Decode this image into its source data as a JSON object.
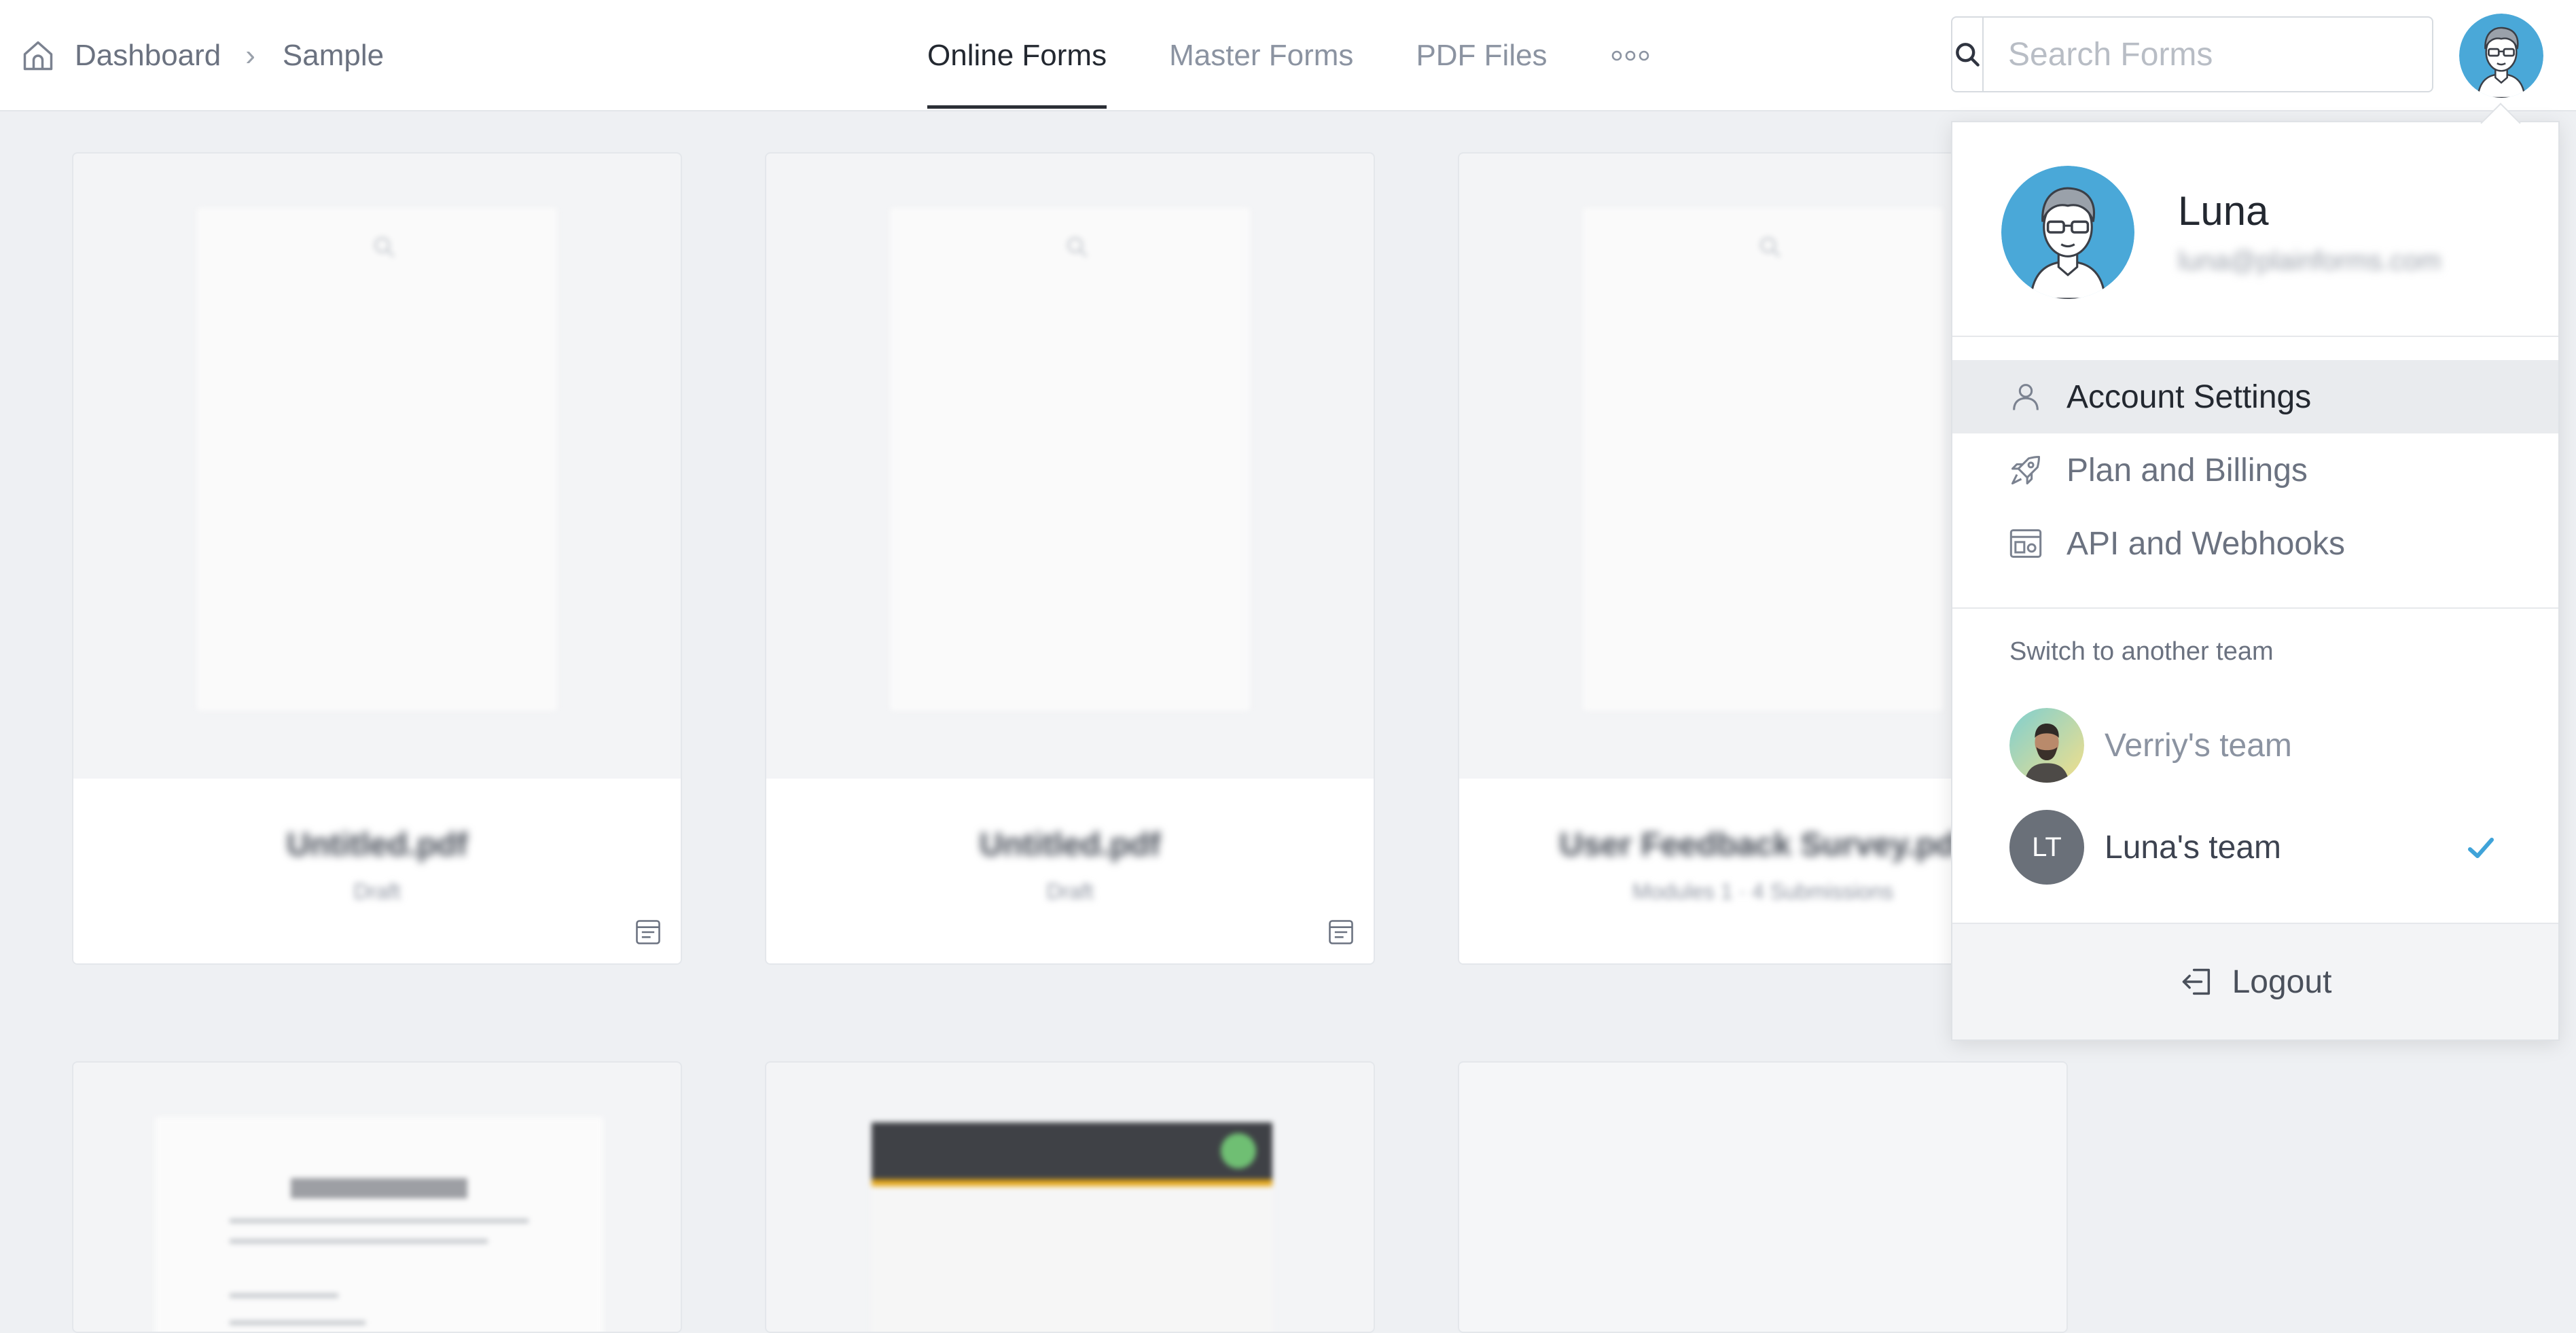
{
  "breadcrumb": {
    "items": [
      "Dashboard",
      "Sample"
    ],
    "home_icon": "home-icon"
  },
  "nav": {
    "tabs": [
      {
        "label": "Online Forms",
        "active": true
      },
      {
        "label": "Master Forms",
        "active": false
      },
      {
        "label": "PDF Files",
        "active": false
      }
    ],
    "more_icon": "more-dots-icon"
  },
  "search": {
    "placeholder": "Search Forms",
    "value": "",
    "icon": "search-icon"
  },
  "cards": [
    {
      "title": "Untitled.pdf",
      "subtitle": "Draft",
      "icon": "form-icon"
    },
    {
      "title": "Untitled.pdf",
      "subtitle": "Draft",
      "icon": "form-icon"
    },
    {
      "title": "User Feedback Survey.pdf",
      "subtitle": "Modules 1 · 4 Submissions"
    }
  ],
  "user_menu": {
    "name": "Luna",
    "email": "luna@plainforms.com",
    "items": [
      {
        "label": "Account Settings",
        "icon": "user-icon",
        "highlighted": true
      },
      {
        "label": "Plan and Billings",
        "icon": "rocket-icon",
        "highlighted": false
      },
      {
        "label": "API and Webhooks",
        "icon": "api-window-icon",
        "highlighted": false
      }
    ],
    "teams_heading": "Switch to another team",
    "teams": [
      {
        "name": "Verriy's team",
        "current": false,
        "avatar": "photo"
      },
      {
        "name": "Luna's team",
        "current": true,
        "initials": "LT"
      }
    ],
    "logout_label": "Logout",
    "logout_icon": "logout-icon"
  },
  "colors": {
    "accent_blue": "#4aa8d8",
    "check_blue": "#3fa3d9",
    "active_tab": "#232830",
    "inactive_tab": "#8b93a1",
    "background": "#eef0f3"
  }
}
